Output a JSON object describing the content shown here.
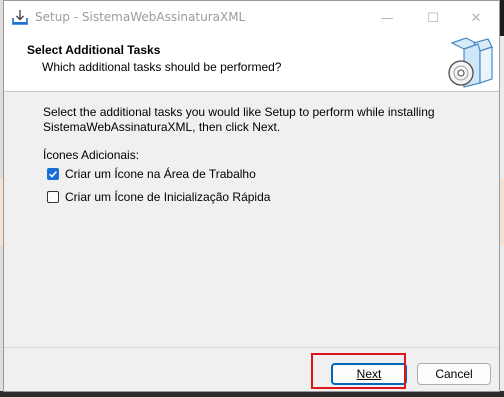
{
  "window": {
    "title": "Setup - SistemaWebAssinaturaXML",
    "controls": {
      "minimize": "—",
      "maximize": "☐",
      "close": "✕"
    }
  },
  "header": {
    "title": "Select Additional Tasks",
    "subtitle": "Which additional tasks should be performed?",
    "icon": "setup-box-cd-icon"
  },
  "content": {
    "description": "Select the additional tasks you would like Setup to perform while installing SistemaWebAssinaturaXML, then click Next.",
    "group_label": "Ícones Adicionais:",
    "tasks": [
      {
        "label": "Criar um Ícone na Área de Trabalho",
        "checked": true
      },
      {
        "label": "Criar um Ícone de Inicialização Rápida",
        "checked": false
      }
    ]
  },
  "buttons": {
    "next": "Next",
    "cancel": "Cancel"
  },
  "colors": {
    "accent": "#1a6ed8",
    "highlight": "#e0141c"
  }
}
